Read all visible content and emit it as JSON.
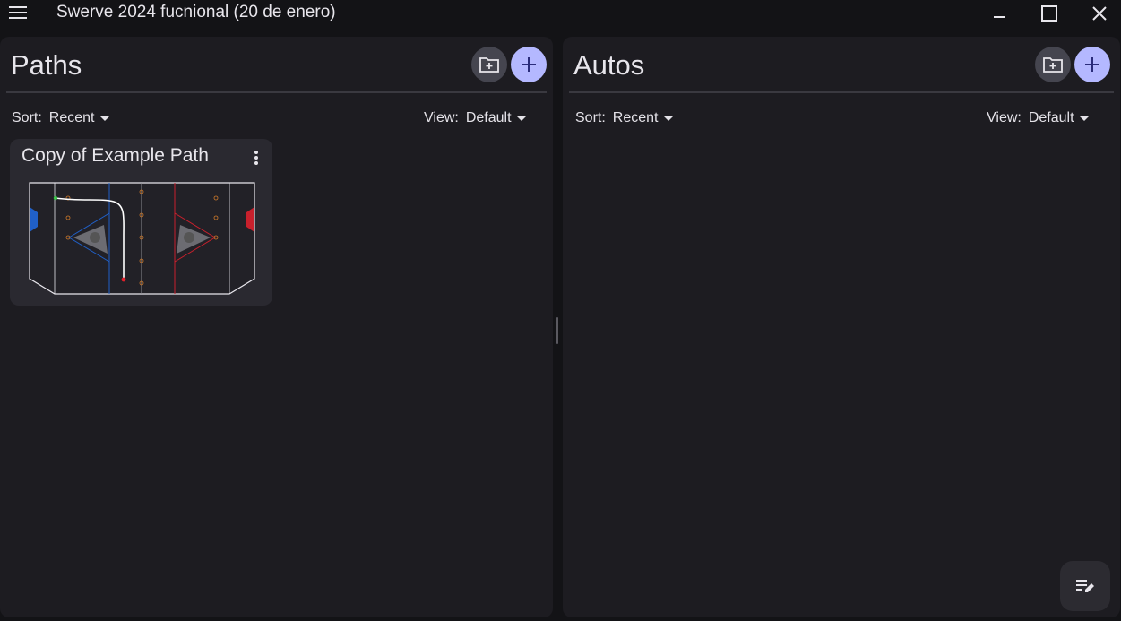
{
  "window": {
    "title": "Swerve 2024 fucnional (20 de enero)",
    "controls": [
      "minimize-icon",
      "maximize-icon",
      "close-icon"
    ]
  },
  "paths_panel": {
    "title": "Paths",
    "sort_label": "Sort:",
    "sort_value": "Recent",
    "view_label": "View:",
    "view_value": "Default",
    "items": [
      {
        "name": "Copy of Example Path"
      }
    ]
  },
  "autos_panel": {
    "title": "Autos",
    "sort_label": "Sort:",
    "sort_value": "Recent",
    "view_label": "View:",
    "view_value": "Default",
    "items": []
  },
  "colors": {
    "accent": "#b4b8ff",
    "panel_bg": "#1d1c21",
    "card_bg": "#2a2930",
    "app_bg": "#131316",
    "blue_alliance": "#2060c8",
    "red_alliance": "#c8202c"
  }
}
